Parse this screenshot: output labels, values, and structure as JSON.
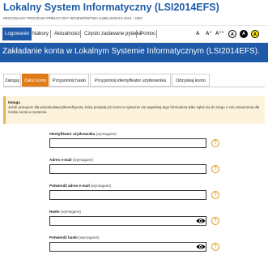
{
  "header": {
    "title": "Lokalny System Informatyczny (LSI2014EFS)",
    "subtitle": "REGIONALNY PROGRAM OPERACYJNY WOJEWÓDZTWA LUBELSKIEGO 2014 - 2020"
  },
  "nav": {
    "items": [
      {
        "label": "Logowanie",
        "active": true
      },
      {
        "label": "Nabory",
        "active": false
      },
      {
        "label": "Aktualności",
        "active": false
      },
      {
        "label": "Często zadawane pytania",
        "active": false
      },
      {
        "label": "Pomoc",
        "active": false
      }
    ],
    "font_tools": [
      "A",
      "A⁺",
      "A⁺⁺"
    ],
    "contrast": [
      "A",
      "A",
      "A"
    ]
  },
  "banner": {
    "heading": "Zakładanie konta w Lokalnym Systemie Informatycznym (LSI2014EFS)."
  },
  "tabs": [
    {
      "label": "Zaloguj",
      "active": false
    },
    {
      "label": "Załóż konto",
      "active": true
    },
    {
      "label": "Przypomnij hasło",
      "active": false
    },
    {
      "label": "Przypomnij identyfikator użytkownika",
      "active": false
    },
    {
      "label": "Odzyskaj konto",
      "active": false
    }
  ],
  "notice": {
    "title": "Uwaga",
    "body": "Jeżeli pracujesz dla wnioskodawcy/beneficjenta, który posiada już konto w systemie nie wypełniaj tego formularza tylko zgłoś się do niego o celu utworzenia dla Ciebie konta w systemie."
  },
  "form": {
    "fields": [
      {
        "label": "Identyfikator użytkownika",
        "note": "(wymagane)",
        "value": "",
        "help": "?"
      },
      {
        "label": "Adres e-mail",
        "note": "(wymagane)",
        "value": "",
        "help": "?"
      },
      {
        "label": "Potwierdź adres e-mail",
        "note": "(wymagane)",
        "value": "",
        "help": "?"
      },
      {
        "label": "Hasło",
        "note": "(wymagane)",
        "value": "",
        "help": "?"
      },
      {
        "label": "Potwierdź hasło",
        "note": "(wymagane)",
        "value": "",
        "help": "?"
      }
    ]
  },
  "colors": {
    "brand_blue": "#1e5aa8",
    "active_tab_orange": "#e07b1a",
    "notice_bg": "#fdf3dc",
    "help_orange": "#e09a1a"
  }
}
